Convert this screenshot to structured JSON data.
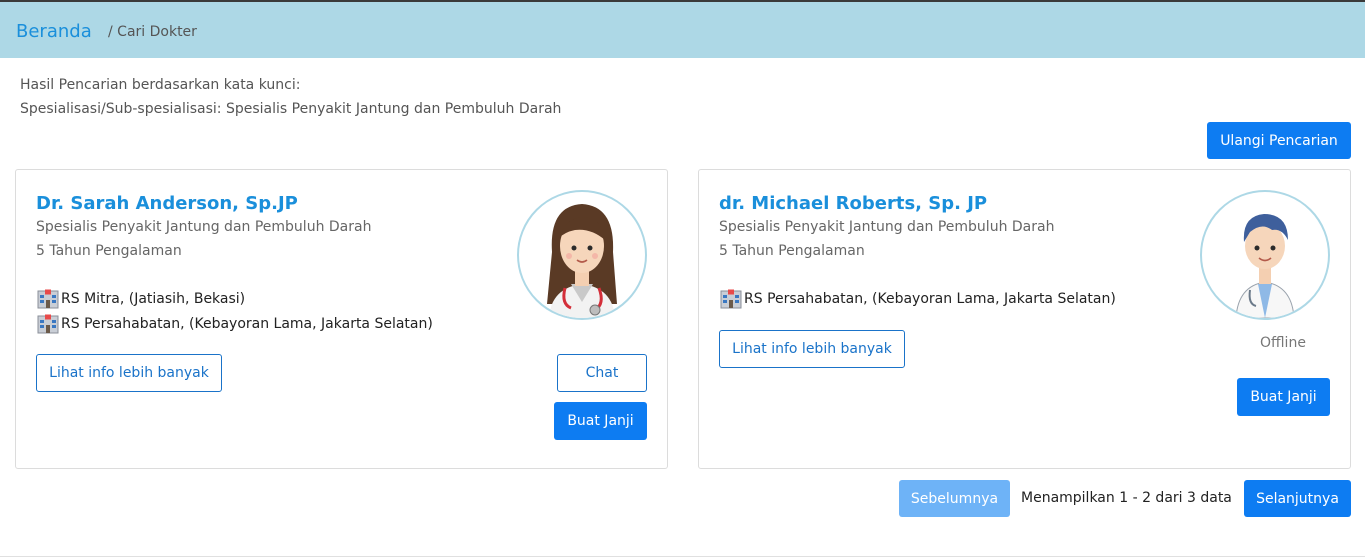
{
  "breadcrumb": {
    "home": "Beranda",
    "current": "/ Cari Dokter"
  },
  "search_info": {
    "line1": "Hasil Pencarian berdasarkan kata kunci:",
    "line2": "Spesialisasi/Sub-spesialisasi: Spesialis Penyakit Jantung dan Pembuluh Darah"
  },
  "actions": {
    "repeat_search": "Ulangi Pencarian"
  },
  "doctors": [
    {
      "name": "Dr. Sarah Anderson, Sp.JP",
      "specialty": "Spesialis Penyakit Jantung dan Pembuluh Darah",
      "experience": "5 Tahun Pengalaman",
      "hospitals": [
        "RS Mitra, (Jatiasih, Bekasi)",
        "RS Persahabatan, (Kebayoran Lama, Jakarta Selatan)"
      ],
      "more_info": "Lihat info lebih banyak",
      "chat": "Chat",
      "appointment": "Buat Janji",
      "avatar_icon": "female-doctor-avatar"
    },
    {
      "name": "dr. Michael Roberts, Sp. JP",
      "specialty": "Spesialis Penyakit Jantung dan Pembuluh Darah",
      "experience": "5 Tahun Pengalaman",
      "hospitals": [
        "RS Persahabatan, (Kebayoran Lama, Jakarta Selatan)"
      ],
      "more_info": "Lihat info lebih banyak",
      "status": "Offline",
      "appointment": "Buat Janji",
      "avatar_icon": "male-doctor-avatar"
    }
  ],
  "pagination": {
    "prev": "Sebelumnya",
    "summary": "Menampilkan 1 - 2 dari 3 data",
    "next": "Selanjutnya"
  },
  "colors": {
    "breadcrumb_bg": "#add8e6",
    "primary": "#0d7cf2",
    "link": "#1a8fdb",
    "disabled": "#6eb3f7"
  }
}
